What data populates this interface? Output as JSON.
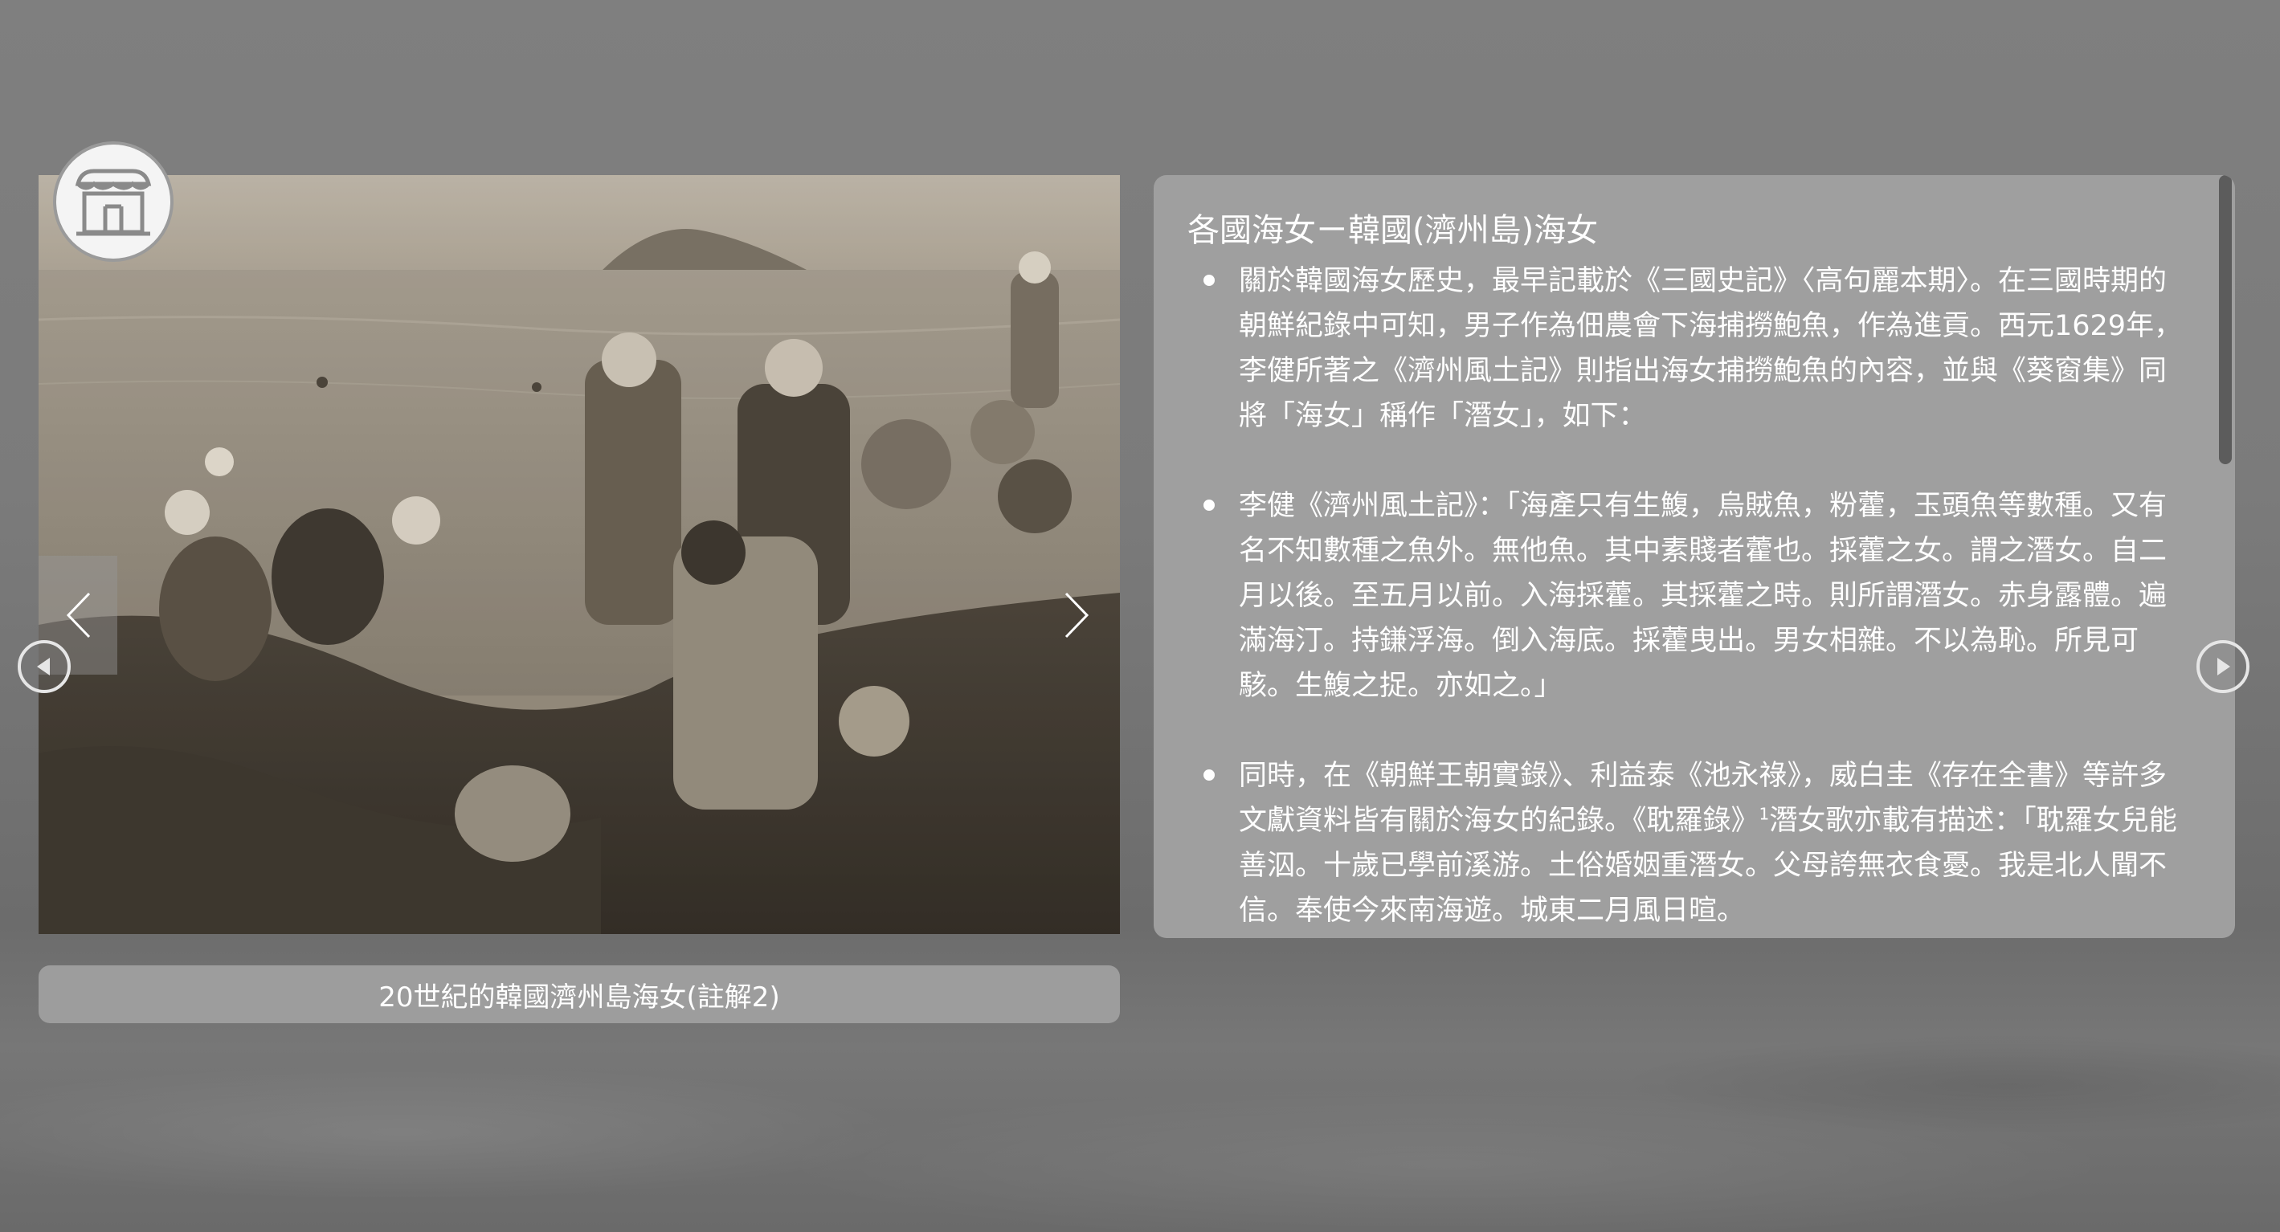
{
  "gallery": {
    "caption": "20世紀的韓國濟州島海女(註解2)",
    "photo_icon": "historical-photo-jeju-haenyeo",
    "prev_icon": "chevron-left-icon",
    "next_icon": "chevron-right-icon",
    "badge_icon": "storefront-icon"
  },
  "article": {
    "title": "各國海女ㄧ韓國(濟州島)海女",
    "paragraphs": [
      {
        "text": "關於韓國海女歷史，最早記載於《三國史記》〈高句麗本期〉。在三國時期的朝鮮紀錄中可知，男子作為佃農會下海捕撈鮑魚，作為進貢。西元1629年，李健所著之《濟州風土記》則指出海女捕撈鮑魚的內容，並與《葵窗集》同將「海女」稱作「潛女」，如下："
      },
      {
        "text": "李健《濟州風土記》：「海產只有生鰒，烏賊魚，粉藿，玉頭魚等數種。又有名不知數種之魚外。無他魚。其中素賤者藿也。採藿之女。謂之潛女。自二月以後。至五月以前。入海採藿。其採藿之時。則所謂潛女。赤身露體。遍滿海汀。持鎌浮海。倒入海底。採藿曳出。男女相雜。不以為恥。所見可駭。生鰒之捉。亦如之。」"
      },
      {
        "text_before": "同時，在《朝鮮王朝實錄》、利益泰《池永祿》，威白圭《存在全書》等許多文獻資料皆有關於海女的紀錄。《耽羅錄》",
        "footnote": "1",
        "text_after": "潛女歌亦載有描述：「耽羅女兒能善泅。十歲已學前溪游。土俗婚姻重潛女。父母誇無衣食憂。我是北人聞不信。奉使今來南海遊。城東二月風日暄。"
      }
    ]
  },
  "nav": {
    "left_icon": "circle-arrow-left-icon",
    "right_icon": "circle-arrow-right-icon"
  },
  "colors": {
    "background": "#7b7b7b",
    "panel": "#9f9f9f",
    "caption_bg": "#9d9d9d",
    "text": "#ffffff",
    "scroll_thumb": "#5c5c5c"
  }
}
